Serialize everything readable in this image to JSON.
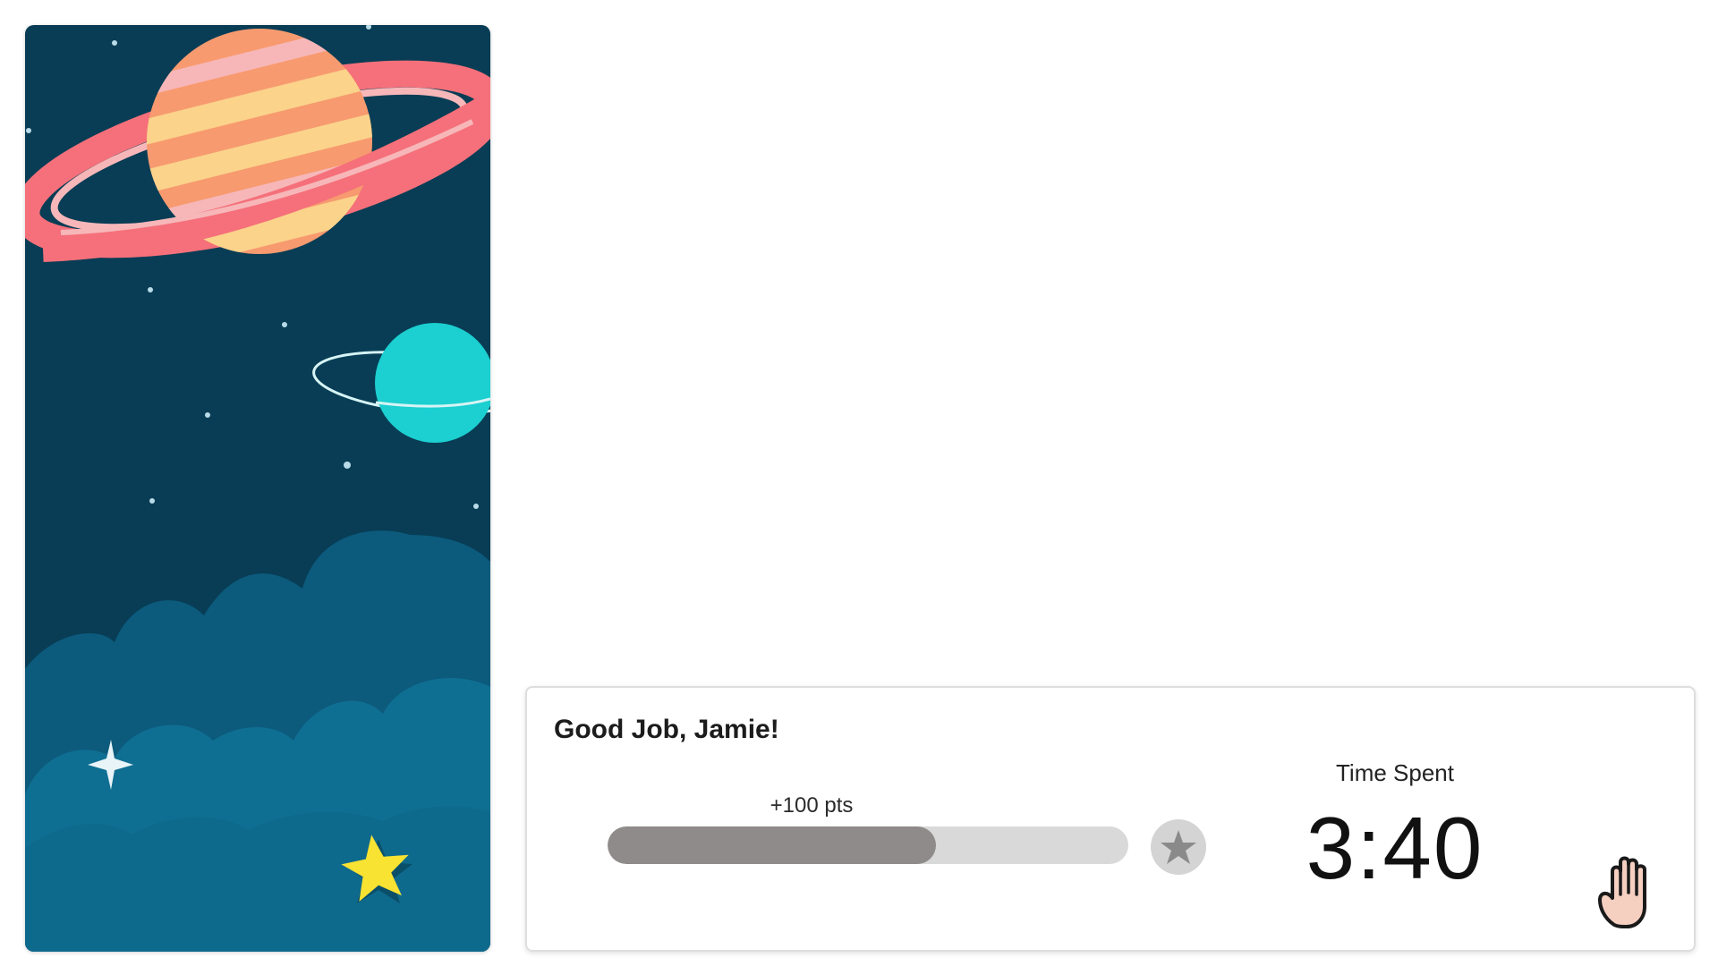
{
  "illustration": {
    "icons": [
      "ringed-planet-icon",
      "small-planet-icon",
      "gold-star-icon",
      "sparkle-icon"
    ],
    "colors": {
      "sky": "#07394f",
      "clouds_far": "#0c5a7c",
      "clouds_near": "#0f6f93",
      "planet_orange": "#f79a6f",
      "planet_stripe": "#fbd38b",
      "ring": "#f5707a",
      "ring_inner": "#f7b7b9",
      "teal_planet": "#1ccfd0",
      "star": "#f8e232"
    }
  },
  "result": {
    "greeting": "Good Job, Jamie!",
    "points_label": "+100 pts",
    "progress_fraction": 0.63,
    "star_icon": "star-icon",
    "time_label": "Time Spent",
    "time_value": "3:40",
    "hand_icon": "raise-hand-icon",
    "colors": {
      "progress_fill": "#8f8b8a",
      "progress_track": "#d9d9d9",
      "star_badge": "#d4d4d4",
      "star": "#8a8a8a",
      "hand_fill": "#f5cfc0"
    }
  }
}
